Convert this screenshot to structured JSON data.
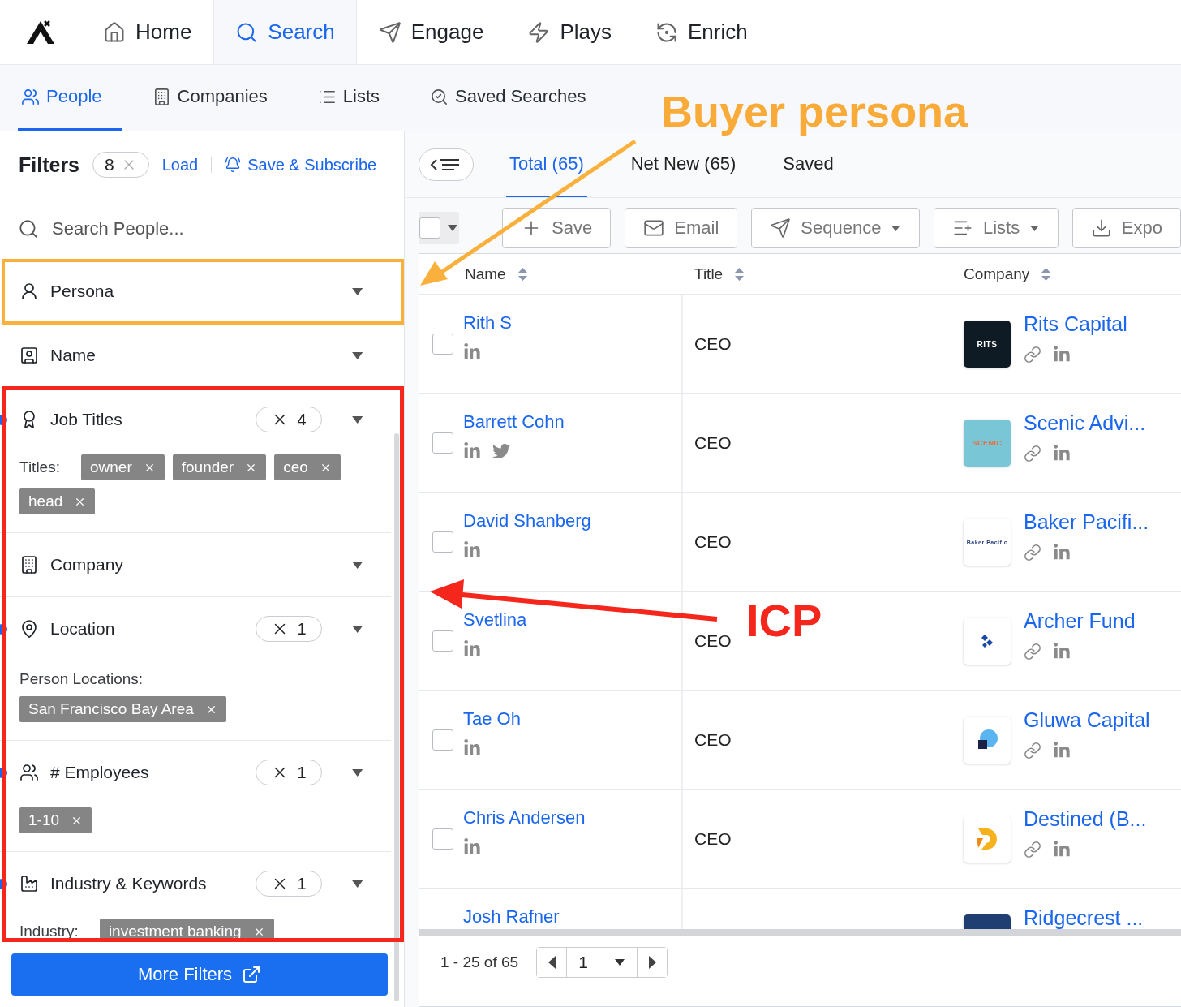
{
  "nav": {
    "items": [
      {
        "label": "Home",
        "selected": false
      },
      {
        "label": "Search",
        "selected": true
      },
      {
        "label": "Engage",
        "selected": false
      },
      {
        "label": "Plays",
        "selected": false
      },
      {
        "label": "Enrich",
        "selected": false
      }
    ]
  },
  "subnav": {
    "items": [
      {
        "label": "People",
        "selected": true
      },
      {
        "label": "Companies",
        "selected": false
      },
      {
        "label": "Lists",
        "selected": false
      },
      {
        "label": "Saved Searches",
        "selected": false
      }
    ]
  },
  "filters": {
    "title": "Filters",
    "count": "8",
    "load": "Load",
    "save_subscribe": "Save & Subscribe",
    "search": {
      "placeholder": "Search People..."
    },
    "items": [
      {
        "label": "Persona",
        "active": false
      },
      {
        "label": "Name",
        "active": false
      },
      {
        "label": "Job Titles",
        "active": true,
        "count": "4",
        "field_label": "Titles:",
        "chips": [
          "owner",
          "founder",
          "ceo",
          "head"
        ]
      },
      {
        "label": "Company",
        "active": false
      },
      {
        "label": "Location",
        "active": true,
        "count": "1",
        "field_label": "Person Locations:",
        "chips": [
          "San Francisco Bay Area"
        ]
      },
      {
        "label": "# Employees",
        "active": true,
        "count": "1",
        "chips": [
          "1-10"
        ]
      },
      {
        "label": "Industry & Keywords",
        "active": true,
        "count": "1",
        "field_label": "Industry:",
        "chips": [
          "investment banking"
        ]
      }
    ],
    "more_button": "More Filters"
  },
  "results": {
    "tabs": [
      {
        "label": "Total (65)",
        "selected": true
      },
      {
        "label": "Net New (65)",
        "selected": false
      },
      {
        "label": "Saved",
        "selected": false
      }
    ],
    "select_all": {
      "checked": false
    },
    "actions": [
      {
        "label": "Save",
        "dropdown": false
      },
      {
        "label": "Email",
        "dropdown": false
      },
      {
        "label": "Sequence",
        "dropdown": true
      },
      {
        "label": "Lists",
        "dropdown": true
      },
      {
        "label": "Expo",
        "dropdown": false
      }
    ],
    "columns": [
      {
        "label": "Name"
      },
      {
        "label": "Title"
      },
      {
        "label": "Company"
      }
    ],
    "rows": [
      {
        "name": "Rith S",
        "twitter": false,
        "title": "CEO",
        "company": "Rits Capital",
        "logo_text": "RITS",
        "checked": false
      },
      {
        "name": "Barrett Cohn",
        "twitter": true,
        "title": "CEO",
        "company": "Scenic Advi...",
        "logo_text": "SCENIC",
        "checked": false
      },
      {
        "name": "David Shanberg",
        "twitter": false,
        "title": "CEO",
        "company": "Baker Pacifi...",
        "logo_text": "Baker Pacific",
        "checked": false
      },
      {
        "name": "Svetlina",
        "twitter": false,
        "title": "CEO",
        "company": "Archer Fund",
        "checked": false
      },
      {
        "name": "Tae Oh",
        "twitter": false,
        "title": "CEO",
        "company": "Gluwa Capital",
        "checked": false
      },
      {
        "name": "Chris Andersen",
        "twitter": false,
        "title": "CEO",
        "company": "Destined (B...",
        "checked": false
      },
      {
        "name": "Josh Rafner",
        "company": "Ridgecrest ..."
      }
    ],
    "pagination": {
      "range": "1 - 25 of 65",
      "page": "1"
    }
  },
  "annotations": {
    "persona_label": "Buyer persona",
    "icp_label": "ICP"
  }
}
